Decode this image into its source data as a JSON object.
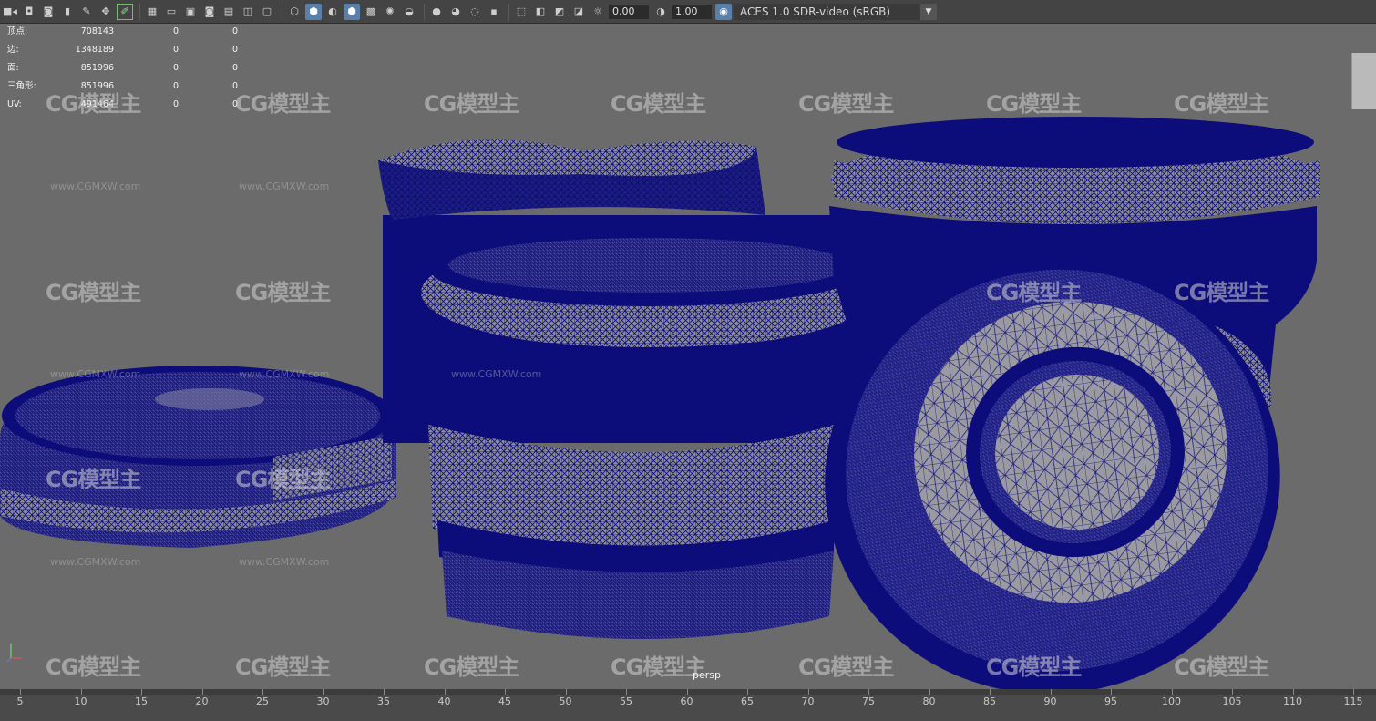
{
  "toolbar": {
    "exposure_value": "0.00",
    "gamma_value": "1.00",
    "color_management": "ACES 1.0 SDR-video (sRGB)"
  },
  "hud": {
    "rows": [
      {
        "label": "顶点:",
        "v1": "708143",
        "v2": "0",
        "v3": "0"
      },
      {
        "label": "边:",
        "v1": "1348189",
        "v2": "0",
        "v3": "0"
      },
      {
        "label": "面:",
        "v1": "851996",
        "v2": "0",
        "v3": "0"
      },
      {
        "label": "三角形:",
        "v1": "851996",
        "v2": "0",
        "v3": "0"
      },
      {
        "label": "UV:",
        "v1": "491464",
        "v2": "0",
        "v3": "0"
      }
    ]
  },
  "viewport": {
    "camera_label": "persp",
    "watermark_text": "CG模型主",
    "watermark_url": "www.CGMXW.com",
    "wire_color": "#0a0a78",
    "surface_color": "#8f8f96"
  },
  "timeline": {
    "ticks": [
      "5",
      "10",
      "15",
      "20",
      "25",
      "30",
      "35",
      "40",
      "45",
      "50",
      "55",
      "60",
      "65",
      "70",
      "75",
      "80",
      "85",
      "90",
      "95",
      "100",
      "105",
      "110",
      "115"
    ]
  }
}
